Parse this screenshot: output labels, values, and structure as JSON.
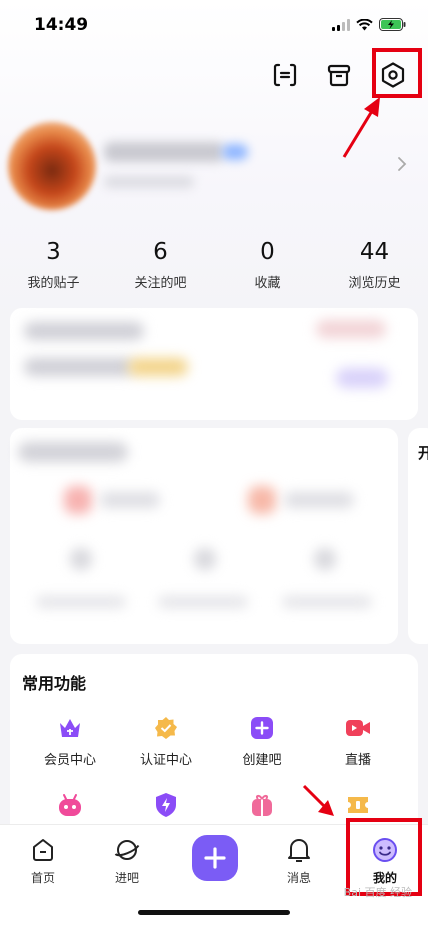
{
  "status_bar": {
    "time": "14:49"
  },
  "profile": {
    "stats": [
      {
        "value": "3",
        "label": "我的贴子"
      },
      {
        "value": "6",
        "label": "关注的吧"
      },
      {
        "value": "0",
        "label": "收藏"
      },
      {
        "value": "44",
        "label": "浏览历史"
      }
    ]
  },
  "side_card": {
    "label": "开"
  },
  "common_functions": {
    "title": "常用功能",
    "items": [
      {
        "label": "会员中心",
        "icon": "crown-icon",
        "color": "#8b4cf7"
      },
      {
        "label": "认证中心",
        "icon": "badge-check-icon",
        "color": "#f5b94a"
      },
      {
        "label": "创建吧",
        "icon": "plus-square-icon",
        "color": "#8b4cf7"
      },
      {
        "label": "直播",
        "icon": "video-camera-icon",
        "color": "#f0405a"
      },
      {
        "label": "",
        "icon": "robot-icon",
        "color": "#f04a9a"
      },
      {
        "label": "",
        "icon": "lightning-shield-icon",
        "color": "#8b4cf7"
      },
      {
        "label": "",
        "icon": "gift-icon",
        "color": "#f06a9a"
      },
      {
        "label": "",
        "icon": "ticket-icon",
        "color": "#f5b94a"
      }
    ]
  },
  "tab_bar": {
    "tabs": [
      {
        "label": "首页",
        "icon": "home-icon"
      },
      {
        "label": "进吧",
        "icon": "planet-icon"
      },
      {
        "label": "",
        "icon": "plus-icon"
      },
      {
        "label": "消息",
        "icon": "bell-icon"
      },
      {
        "label": "我的",
        "icon": "smiley-icon",
        "active": true
      }
    ]
  },
  "watermark": "Bai 百度 经验",
  "colors": {
    "accent": "#7b5cf5",
    "highlight": "#e50012"
  }
}
